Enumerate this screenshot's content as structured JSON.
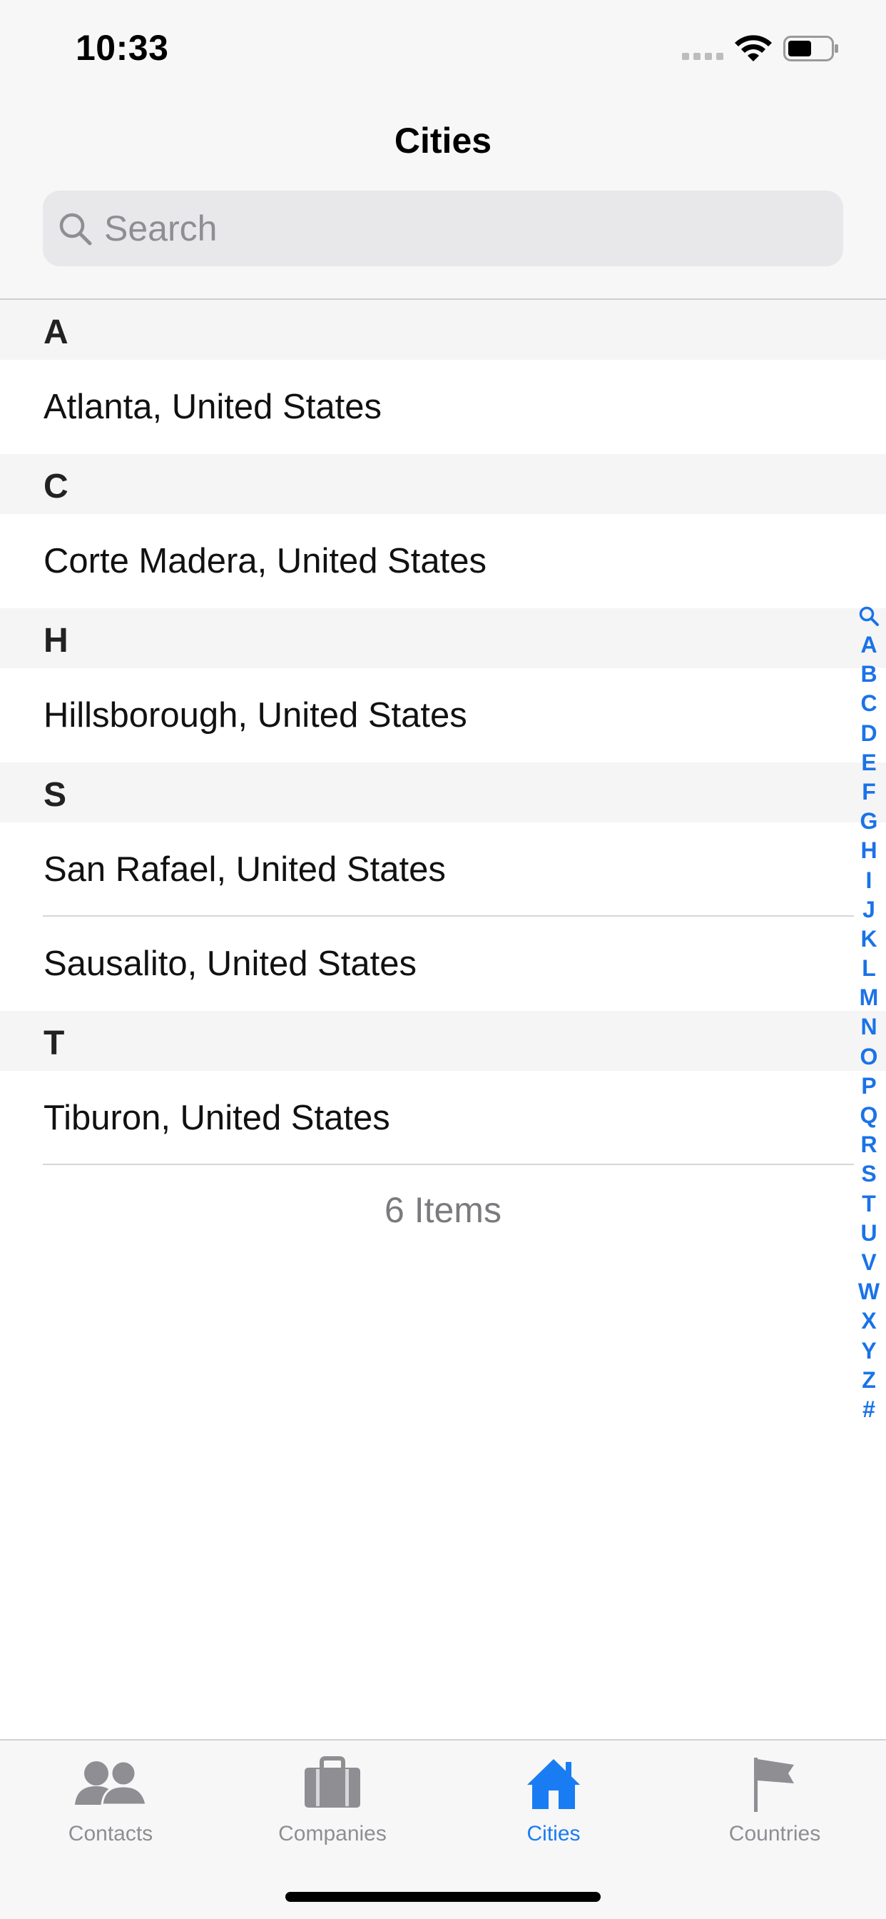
{
  "status": {
    "time": "10:33"
  },
  "nav": {
    "title": "Cities"
  },
  "search": {
    "placeholder": "Search"
  },
  "sections": [
    {
      "letter": "A",
      "rows": [
        "Atlanta, United States"
      ]
    },
    {
      "letter": "C",
      "rows": [
        "Corte Madera, United States"
      ]
    },
    {
      "letter": "H",
      "rows": [
        "Hillsborough, United States"
      ]
    },
    {
      "letter": "S",
      "rows": [
        "San Rafael, United States",
        "Sausalito, United States"
      ]
    },
    {
      "letter": "T",
      "rows": [
        "Tiburon, United States"
      ]
    }
  ],
  "footer": {
    "count": "6 Items"
  },
  "index_letters": [
    "A",
    "B",
    "C",
    "D",
    "E",
    "F",
    "G",
    "H",
    "I",
    "J",
    "K",
    "L",
    "M",
    "N",
    "O",
    "P",
    "Q",
    "R",
    "S",
    "T",
    "U",
    "V",
    "W",
    "X",
    "Y",
    "Z",
    "#"
  ],
  "tabs": [
    {
      "label": "Contacts",
      "icon": "contacts-icon",
      "active": false
    },
    {
      "label": "Companies",
      "icon": "briefcase-icon",
      "active": false
    },
    {
      "label": "Cities",
      "icon": "home-icon",
      "active": true
    },
    {
      "label": "Countries",
      "icon": "flag-icon",
      "active": false
    }
  ],
  "colors": {
    "accent": "#1a7cf2",
    "inactive": "#8e8e93",
    "section_bg": "#f5f5f6"
  }
}
